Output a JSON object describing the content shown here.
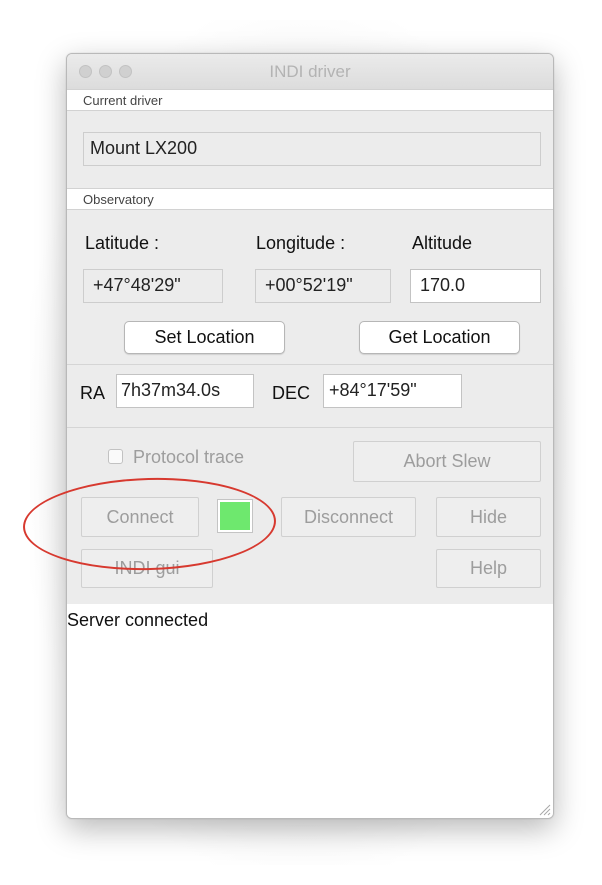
{
  "window": {
    "title": "INDI driver"
  },
  "current_driver": {
    "section_label": "Current driver",
    "value": "Mount LX200"
  },
  "observatory": {
    "section_label": "Observatory",
    "latitude_label": "Latitude :",
    "longitude_label": "Longitude :",
    "altitude_label": "Altitude",
    "latitude_value": "+47°48'29\"",
    "longitude_value": "+00°52'19\"",
    "altitude_value": "170.0",
    "set_location_label": "Set Location",
    "get_location_label": "Get Location"
  },
  "coords": {
    "ra_label": "RA",
    "ra_value": "7h37m34.0s",
    "dec_label": "DEC",
    "dec_value": "+84°17'59\""
  },
  "controls": {
    "protocol_trace_label": "Protocol trace",
    "protocol_trace_checked": false,
    "abort_slew_label": "Abort Slew",
    "connect_label": "Connect",
    "disconnect_label": "Disconnect",
    "hide_label": "Hide",
    "indi_gui_label": "INDI gui",
    "help_label": "Help",
    "status_color": "#6ee86e"
  },
  "log": {
    "lines": [
      "Server connected"
    ]
  },
  "colors": {
    "annotation_oval": "#d7392f"
  }
}
